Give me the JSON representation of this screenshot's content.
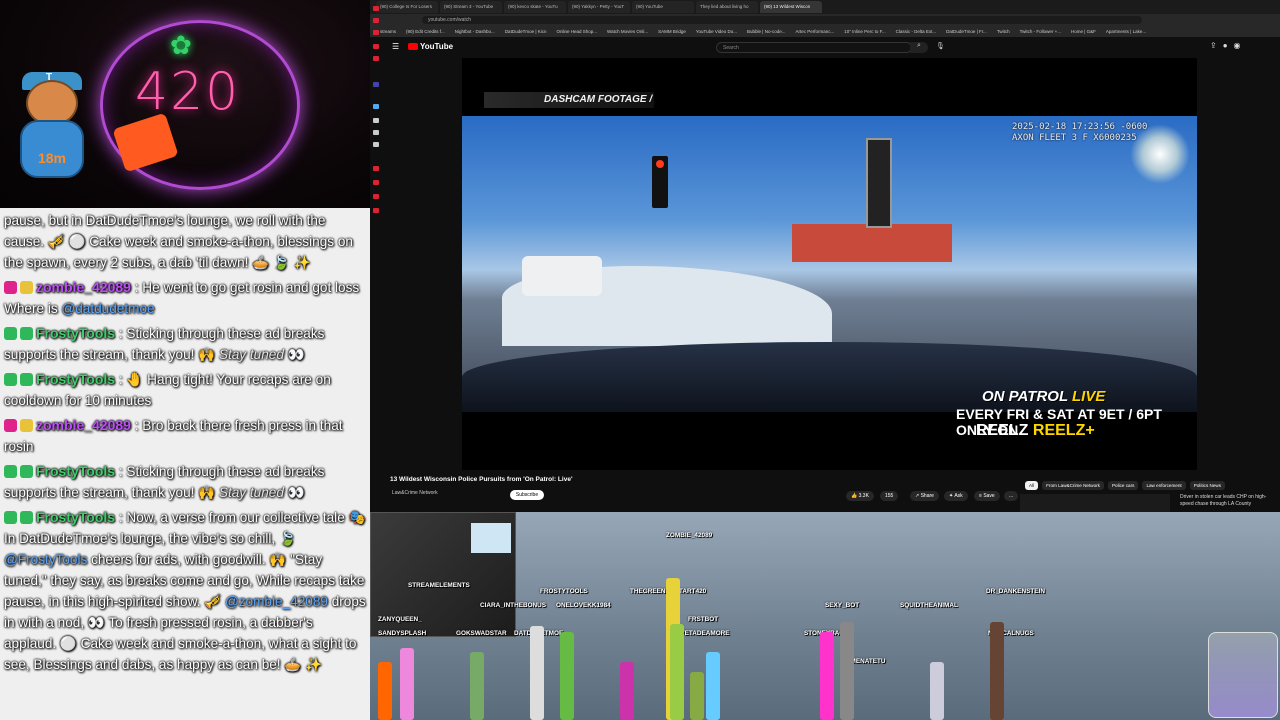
{
  "overlay": {
    "neon_number": "420",
    "mascot_timer": "18m",
    "mascot_letter": "T"
  },
  "chat": [
    {
      "user": "",
      "parts": [
        {
          "t": "pause, but in DatDudeTmoe's lounge, we roll with the cause. 🎺 ⚪ Cake week and smoke-a-thon, blessings on the spawn, every 2 subs, a dab 'til dawn! 🥧 🍃 ✨"
        }
      ]
    },
    {
      "user": "zombie_42089",
      "badges": [
        "vip",
        "sub"
      ],
      "parts": [
        {
          "t": "He went to go get rosin and got loss Where is "
        },
        {
          "m": "@datdudetmoe"
        }
      ]
    },
    {
      "user": "FrostyTools",
      "badges": [
        "mod",
        "bot"
      ],
      "parts": [
        {
          "t": "Sticking through these ad breaks supports the stream, thank you! 🙌 "
        },
        {
          "e": "Stay tuned"
        },
        {
          "t": " 👀"
        }
      ]
    },
    {
      "user": "FrostyTools",
      "badges": [
        "mod",
        "bot"
      ],
      "parts": [
        {
          "t": "🤚 Hang tight! Your recaps are on cooldown for 10 minutes"
        }
      ]
    },
    {
      "user": "zombie_42089",
      "badges": [
        "vip",
        "sub"
      ],
      "parts": [
        {
          "t": "Bro back there fresh press in that rosin"
        }
      ]
    },
    {
      "user": "FrostyTools",
      "badges": [
        "mod",
        "bot"
      ],
      "parts": [
        {
          "t": "Sticking through these ad breaks supports the stream, thank you! 🙌 "
        },
        {
          "e": "Stay tuned"
        },
        {
          "t": " 👀"
        }
      ]
    },
    {
      "user": "FrostyTools",
      "badges": [
        "mod",
        "bot"
      ],
      "parts": [
        {
          "t": "Now, a verse from our collective tale 🎭 In DatDudeTmoe's lounge, the vibe's so chill, 🍃 "
        },
        {
          "m": "@FrostyTools"
        },
        {
          "t": " cheers for ads, with goodwill. 🙌 \"Stay tuned,\" they say, as breaks come and go, While recaps take pause, in this high-spirited show. 🎺 "
        },
        {
          "m": "@zombie_42089"
        },
        {
          "t": " drops in with a nod, 👀 To fresh pressed rosin, a dabber's applaud. ⚪ Cake week and smoke-a-thon, what a sight to see, Blessings and dabs, as happy as can be! 🥧 ✨"
        }
      ]
    }
  ],
  "browser": {
    "tabs": [
      "(90) College Is For Losers",
      "(90) Stream 3 - YouTube",
      "(90) kevco skate - YouTu",
      "(90) Yakkyn - Petty - YouT",
      "(90) YouTube",
      "They lied about living ho",
      "(90) 13 Wildest Wiscon"
    ],
    "active_tab": 6,
    "url": "youtube.com/watch",
    "bookmarks": [
      "streams",
      "(90) Edit Credits f...",
      "Nightbot - Dashbo...",
      "DatDudeTmoe | Kicn",
      "Online Head Shop...",
      "Watch Movies Onli...",
      "SAMM Bridge",
      "YouTube Video Do...",
      "Bubble | No-code...",
      "Artec Performanc...",
      "10\" Inline Perc to F...",
      "Classic - Delta Ext...",
      "DatDudeTmoe | Fr...",
      "Twitch",
      "Twitch - Follower +...",
      "Home | G&F",
      "Apartments | Lake..."
    ],
    "search_placeholder": "Search",
    "logo_text": "YouTube"
  },
  "video": {
    "label": "DASHCAM FOOTAGE",
    "timestamp_line1": "2025-02-18 17:23:56 -0600",
    "timestamp_line2": "AXON FLEET 3 F X6000235",
    "promo_show": "ON PATROL",
    "promo_live": "LIVE",
    "promo_schedule": "EVERY FRI & SAT AT 9ET / 6PT ONLY ON",
    "promo_network": "REELZ",
    "promo_network2": "REELZ+",
    "title": "13 Wildest Wisconsin Police Pursuits from 'On Patrol: Live'",
    "channel": "Law&Crime Network",
    "subscribe": "Subscribe",
    "likes": "3.3K",
    "dislikes": "155",
    "share": "Share",
    "ask": "Ask",
    "save": "Save",
    "more": "...",
    "chips": [
      "All",
      "From Law&Crime Network",
      "Police cars",
      "Law enforcement",
      "Politics News"
    ],
    "recommended_title": "Driver in stolen car leads CHP on high-speed chase through LA County"
  },
  "game": {
    "names": [
      {
        "n": "ZOMBIE_42089"
      },
      {
        "n": "STREAMELEMENTS"
      },
      {
        "n": "FROSTYTOOLS"
      },
      {
        "n": "THEGREENPOPTART420"
      },
      {
        "n": "ONELOVEKK1984"
      },
      {
        "n": "CIARA_INTHEBONUS"
      },
      {
        "n": "ZANYQUEEN_"
      },
      {
        "n": "SANDYSPLASH"
      },
      {
        "n": "GOKSWADSTAR"
      },
      {
        "n": "DATDUDETMOE"
      },
      {
        "n": "SEXY_BOT"
      },
      {
        "n": "SQUIDTHEANIMAL"
      },
      {
        "n": "DR_DANKENSTEIN"
      },
      {
        "n": "DELVETADEAMORE"
      },
      {
        "n": "STONEYBACK"
      },
      {
        "n": "NORCALNUGS"
      },
      {
        "n": "LUMENATETU"
      },
      {
        "n": "FRSTBOT"
      }
    ]
  }
}
